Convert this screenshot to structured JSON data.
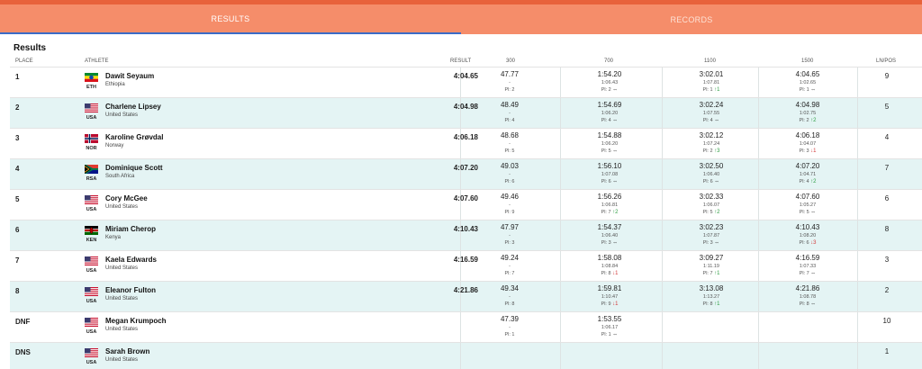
{
  "tabs": [
    {
      "label": "RESULTS",
      "active": true
    },
    {
      "label": "RECORDS",
      "active": false
    }
  ],
  "section_title": "Results",
  "columns": {
    "place": "PLACE",
    "athlete": "ATHLETE",
    "result": "RESULT",
    "split1": "300",
    "split2": "700",
    "split3": "1100",
    "split4": "1500",
    "lnpos": "LN/POS"
  },
  "colors": {
    "accent": "#f58d6a",
    "accent_dark": "#e8623b",
    "row_alt": "#e4f4f4",
    "up": "#2f9e44",
    "down": "#d23b3b"
  },
  "rows": [
    {
      "place": "1",
      "name": "Dawit Seyaum",
      "country": "Ethiopia",
      "code": "ETH",
      "flag": "eth-flag",
      "result": "4:04.65",
      "lnpos": "9",
      "s300": {
        "time": "47.77",
        "gap": "-",
        "pl": "Pl: 2",
        "move": "",
        "dir": ""
      },
      "s700": {
        "time": "1:54.20",
        "gap": "1:06.43",
        "pl": "Pl: 2",
        "move": "⇔",
        "dir": "same"
      },
      "s1100": {
        "time": "3:02.01",
        "gap": "1:07.81",
        "pl": "Pl: 1",
        "move": "↑1",
        "dir": "up"
      },
      "s1500": {
        "time": "4:04.65",
        "gap": "1:02.65",
        "pl": "Pl: 1",
        "move": "⇔",
        "dir": "same"
      }
    },
    {
      "place": "2",
      "name": "Charlene Lipsey",
      "country": "United States",
      "code": "USA",
      "flag": "usa-flag",
      "result": "4:04.98",
      "lnpos": "5",
      "s300": {
        "time": "48.49",
        "gap": "-",
        "pl": "Pl: 4",
        "move": "",
        "dir": ""
      },
      "s700": {
        "time": "1:54.69",
        "gap": "1:06.20",
        "pl": "Pl: 4",
        "move": "⇔",
        "dir": "same"
      },
      "s1100": {
        "time": "3:02.24",
        "gap": "1:07.55",
        "pl": "Pl: 4",
        "move": "⇔",
        "dir": "same"
      },
      "s1500": {
        "time": "4:04.98",
        "gap": "1:02.75",
        "pl": "Pl: 2",
        "move": "↑2",
        "dir": "up"
      }
    },
    {
      "place": "3",
      "name": "Karoline Grøvdal",
      "country": "Norway",
      "code": "NOR",
      "flag": "nor-flag",
      "result": "4:06.18",
      "lnpos": "4",
      "s300": {
        "time": "48.68",
        "gap": "-",
        "pl": "Pl: 5",
        "move": "",
        "dir": ""
      },
      "s700": {
        "time": "1:54.88",
        "gap": "1:06.20",
        "pl": "Pl: 5",
        "move": "⇔",
        "dir": "same"
      },
      "s1100": {
        "time": "3:02.12",
        "gap": "1:07.24",
        "pl": "Pl: 2",
        "move": "↑3",
        "dir": "up"
      },
      "s1500": {
        "time": "4:06.18",
        "gap": "1:04.07",
        "pl": "Pl: 3",
        "move": "↓1",
        "dir": "down"
      }
    },
    {
      "place": "4",
      "name": "Dominique Scott",
      "country": "South Africa",
      "code": "RSA",
      "flag": "rsa-flag",
      "result": "4:07.20",
      "lnpos": "7",
      "s300": {
        "time": "49.03",
        "gap": "-",
        "pl": "Pl: 6",
        "move": "",
        "dir": ""
      },
      "s700": {
        "time": "1:56.10",
        "gap": "1:07.08",
        "pl": "Pl: 6",
        "move": "⇔",
        "dir": "same"
      },
      "s1100": {
        "time": "3:02.50",
        "gap": "1:06.40",
        "pl": "Pl: 6",
        "move": "⇔",
        "dir": "same"
      },
      "s1500": {
        "time": "4:07.20",
        "gap": "1:04.71",
        "pl": "Pl: 4",
        "move": "↑2",
        "dir": "up"
      }
    },
    {
      "place": "5",
      "name": "Cory McGee",
      "country": "United States",
      "code": "USA",
      "flag": "usa-flag",
      "result": "4:07.60",
      "lnpos": "6",
      "s300": {
        "time": "49.46",
        "gap": "-",
        "pl": "Pl: 9",
        "move": "",
        "dir": ""
      },
      "s700": {
        "time": "1:56.26",
        "gap": "1:06.81",
        "pl": "Pl: 7",
        "move": "↑2",
        "dir": "up"
      },
      "s1100": {
        "time": "3:02.33",
        "gap": "1:06.07",
        "pl": "Pl: 5",
        "move": "↑2",
        "dir": "up"
      },
      "s1500": {
        "time": "4:07.60",
        "gap": "1:05.27",
        "pl": "Pl: 5",
        "move": "⇔",
        "dir": "same"
      }
    },
    {
      "place": "6",
      "name": "Miriam Cherop",
      "country": "Kenya",
      "code": "KEN",
      "flag": "ken-flag",
      "result": "4:10.43",
      "lnpos": "8",
      "s300": {
        "time": "47.97",
        "gap": "-",
        "pl": "Pl: 3",
        "move": "",
        "dir": ""
      },
      "s700": {
        "time": "1:54.37",
        "gap": "1:06.40",
        "pl": "Pl: 3",
        "move": "⇔",
        "dir": "same"
      },
      "s1100": {
        "time": "3:02.23",
        "gap": "1:07.87",
        "pl": "Pl: 3",
        "move": "⇔",
        "dir": "same"
      },
      "s1500": {
        "time": "4:10.43",
        "gap": "1:08.20",
        "pl": "Pl: 6",
        "move": "↓3",
        "dir": "down"
      }
    },
    {
      "place": "7",
      "name": "Kaela Edwards",
      "country": "United States",
      "code": "USA",
      "flag": "usa-flag",
      "result": "4:16.59",
      "lnpos": "3",
      "s300": {
        "time": "49.24",
        "gap": "-",
        "pl": "Pl: 7",
        "move": "",
        "dir": ""
      },
      "s700": {
        "time": "1:58.08",
        "gap": "1:08.84",
        "pl": "Pl: 8",
        "move": "↓1",
        "dir": "down"
      },
      "s1100": {
        "time": "3:09.27",
        "gap": "1:11.19",
        "pl": "Pl: 7",
        "move": "↑1",
        "dir": "up"
      },
      "s1500": {
        "time": "4:16.59",
        "gap": "1:07.33",
        "pl": "Pl: 7",
        "move": "⇔",
        "dir": "same"
      }
    },
    {
      "place": "8",
      "name": "Eleanor Fulton",
      "country": "United States",
      "code": "USA",
      "flag": "usa-flag",
      "result": "4:21.86",
      "lnpos": "2",
      "s300": {
        "time": "49.34",
        "gap": "-",
        "pl": "Pl: 8",
        "move": "",
        "dir": ""
      },
      "s700": {
        "time": "1:59.81",
        "gap": "1:10.47",
        "pl": "Pl: 9",
        "move": "↓1",
        "dir": "down"
      },
      "s1100": {
        "time": "3:13.08",
        "gap": "1:13.27",
        "pl": "Pl: 8",
        "move": "↑1",
        "dir": "up"
      },
      "s1500": {
        "time": "4:21.86",
        "gap": "1:08.78",
        "pl": "Pl: 8",
        "move": "⇔",
        "dir": "same"
      }
    },
    {
      "place": "DNF",
      "name": "Megan Krumpoch",
      "country": "United States",
      "code": "USA",
      "flag": "usa-flag",
      "result": "",
      "lnpos": "10",
      "s300": {
        "time": "47.39",
        "gap": "-",
        "pl": "Pl: 1",
        "move": "",
        "dir": ""
      },
      "s700": {
        "time": "1:53.55",
        "gap": "1:06.17",
        "pl": "Pl: 1",
        "move": "⇔",
        "dir": "same"
      },
      "s1100": {
        "time": "",
        "gap": "",
        "pl": "",
        "move": "",
        "dir": ""
      },
      "s1500": {
        "time": "",
        "gap": "",
        "pl": "",
        "move": "",
        "dir": ""
      }
    },
    {
      "place": "DNS",
      "name": "Sarah Brown",
      "country": "United States",
      "code": "USA",
      "flag": "usa-flag",
      "result": "",
      "lnpos": "1",
      "s300": {
        "time": "",
        "gap": "",
        "pl": "",
        "move": "",
        "dir": ""
      },
      "s700": {
        "time": "",
        "gap": "",
        "pl": "",
        "move": "",
        "dir": ""
      },
      "s1100": {
        "time": "",
        "gap": "",
        "pl": "",
        "move": "",
        "dir": ""
      },
      "s1500": {
        "time": "",
        "gap": "",
        "pl": "",
        "move": "",
        "dir": ""
      }
    }
  ]
}
